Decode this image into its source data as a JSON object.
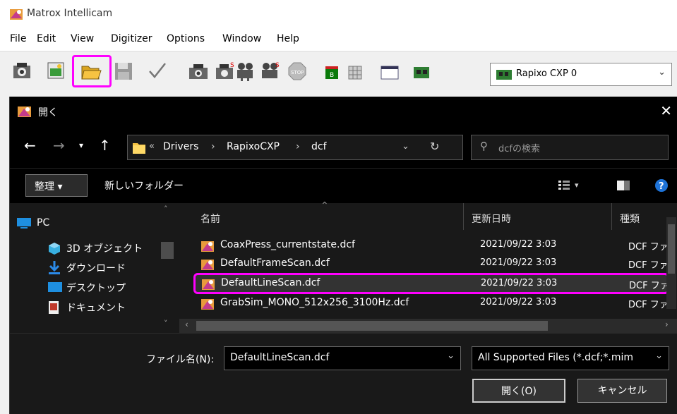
{
  "app": {
    "title": "Matrox Intellicam",
    "menu": [
      "File",
      "Edit",
      "View",
      "Digitizer",
      "Options",
      "Window",
      "Help"
    ],
    "device": "Rapixo CXP 0"
  },
  "dialog": {
    "title": "開く",
    "breadcrumb": [
      "«",
      "Drivers",
      "›",
      "RapixoCXP",
      "›",
      "dcf"
    ],
    "search_placeholder": "dcfの検索",
    "organize_label": "整理 ▾",
    "new_folder_label": "新しいフォルダー",
    "nav_items": [
      "PC",
      "3D オブジェクト",
      "ダウンロード",
      "デスクトップ",
      "ドキュメント"
    ],
    "columns": [
      "名前",
      "更新日時",
      "種類"
    ],
    "files": [
      {
        "name": "CoaxPress_currentstate.dcf",
        "date": "2021/09/22 3:03",
        "type": "DCF ファイ"
      },
      {
        "name": "DefaultFrameScan.dcf",
        "date": "2021/09/22 3:03",
        "type": "DCF ファイ"
      },
      {
        "name": "DefaultLineScan.dcf",
        "date": "2021/09/22 3:03",
        "type": "DCF ファイ"
      },
      {
        "name": "GrabSim_MONO_512x256_3100Hz.dcf",
        "date": "2021/09/22 3:03",
        "type": "DCF ファイ"
      }
    ],
    "filename_label": "ファイル名(N):",
    "filename_value": "DefaultLineScan.dcf",
    "filetype_value": "All Supported Files (*.dcf;*.mim",
    "open_label": "開く(O)",
    "cancel_label": "キャンセル"
  },
  "colors": {
    "highlight": "#ff00ff",
    "accent": "#f6c342"
  }
}
